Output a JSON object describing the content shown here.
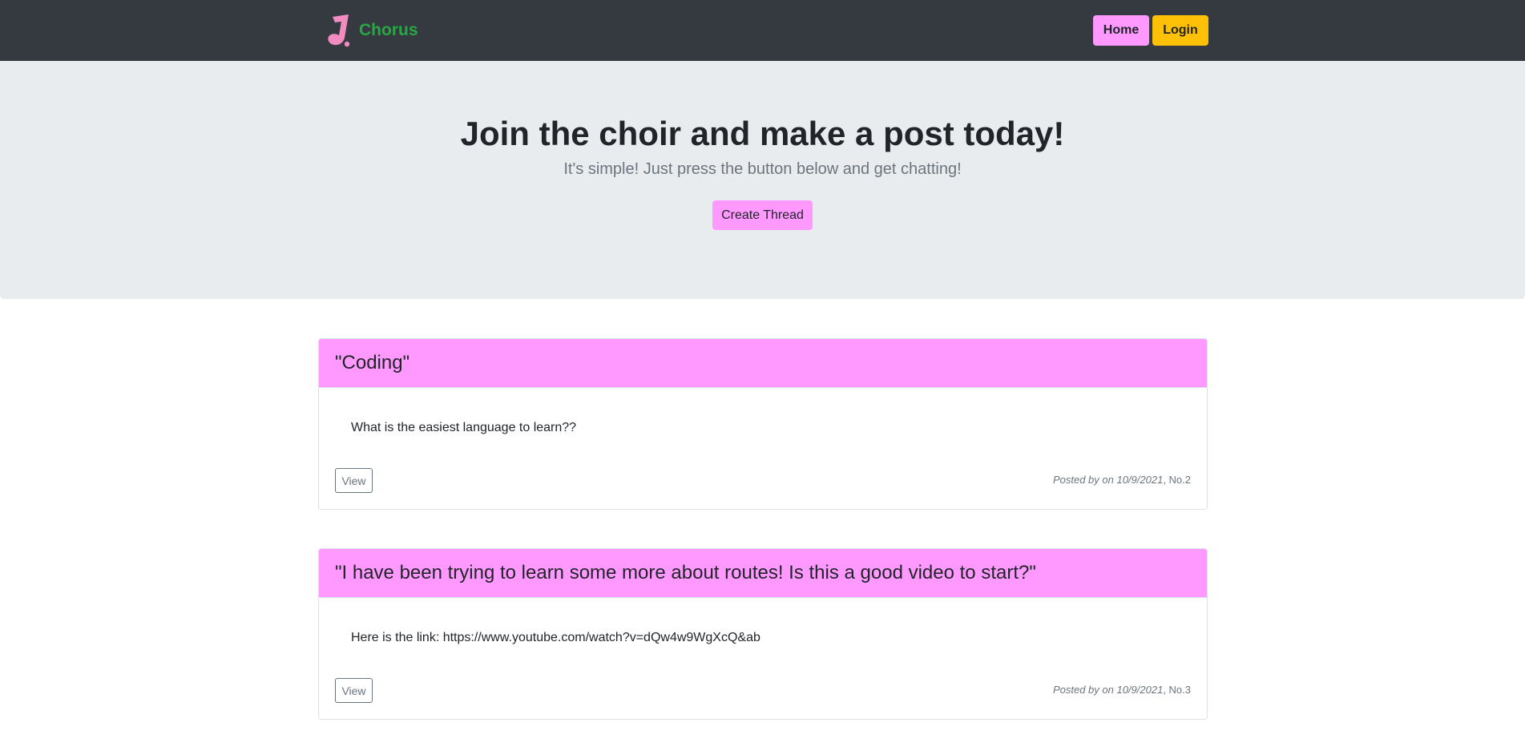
{
  "navbar": {
    "brand": "Chorus",
    "logo_icon": "music-note-icon",
    "home_label": "Home",
    "login_label": "Login"
  },
  "jumbotron": {
    "title": "Join the choir and make a post today!",
    "lead": "It's simple! Just press the button below and get chatting!",
    "create_label": "Create Thread"
  },
  "threads": [
    {
      "title": "\"Coding\"",
      "body": "What is the easiest language to learn??",
      "view_label": "View",
      "posted": "Posted by on 10/9/2021",
      "number": ", No.2"
    },
    {
      "title": "\"I have been trying to learn some more about routes! Is this a good video to start?\"",
      "body": "Here is the link: https://www.youtube.com/watch?v=dQw4w9WgXcQ&ab",
      "view_label": "View",
      "posted": "Posted by on 10/9/2021",
      "number": ", No.3"
    }
  ],
  "colors": {
    "navbar": "#343a40",
    "brand": "#28a745",
    "pink": "#ff99ff",
    "yellow": "#ffc107",
    "jumbotron": "#e9ecef"
  }
}
